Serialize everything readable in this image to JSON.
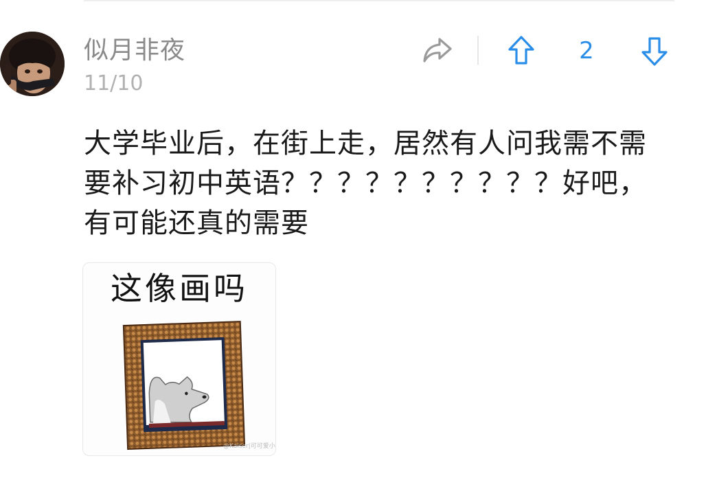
{
  "comment": {
    "author": "似月非夜",
    "date": "11/10",
    "body": "大学毕业后，在街上走，居然有人问我需不需要补习初中英语？？？？？？？？？？好吧，有可能还真的需要",
    "actions": {
      "share_icon": "share-arrow-icon",
      "upvote_icon": "arrow-up-outline-icon",
      "downvote_icon": "arrow-down-outline-icon",
      "vote_count": "2"
    },
    "image": {
      "caption": "这像画吗",
      "watermark": "@Kaiser|可可爱小怪"
    }
  },
  "colors": {
    "accent": "#2a8ee8",
    "name": "#8a8a8a",
    "date": "#b0b0b0",
    "text": "#1a1a1a",
    "icon_gray": "#9a9a9a"
  }
}
